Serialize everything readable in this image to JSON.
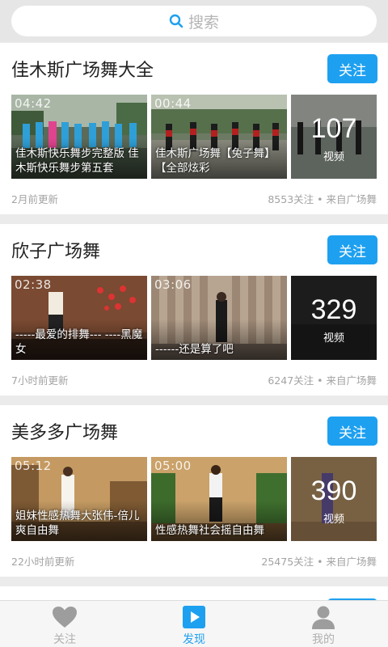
{
  "search": {
    "placeholder": "搜索"
  },
  "channels": [
    {
      "title": "佳木斯广场舞大全",
      "follow_label": "关注",
      "videos": [
        {
          "duration": "04:42",
          "caption": "佳木斯快乐舞步完整版 佳木斯快乐舞步第五套"
        },
        {
          "duration": "00:44",
          "caption": "佳木斯广场舞【兔子舞】【全部炫彩"
        }
      ],
      "video_count": "107",
      "video_count_label": "视频",
      "updated": "2月前更新",
      "stats": "8553关注 • 来自广场舞"
    },
    {
      "title": "欣子广场舞",
      "follow_label": "关注",
      "videos": [
        {
          "duration": "02:38",
          "caption": "-----最爱的排舞--- ----黑魔女"
        },
        {
          "duration": "03:06",
          "caption": "------还是算了吧"
        }
      ],
      "video_count": "329",
      "video_count_label": "视频",
      "updated": "7小时前更新",
      "stats": "6247关注 • 来自广场舞"
    },
    {
      "title": "美多多广场舞",
      "follow_label": "关注",
      "videos": [
        {
          "duration": "05:12",
          "caption": "姐妹性感热舞大张伟-倍儿爽自由舞"
        },
        {
          "duration": "05:00",
          "caption": "性感热舞社会摇自由舞"
        }
      ],
      "video_count": "390",
      "video_count_label": "视频",
      "updated": "22小时前更新",
      "stats": "25475关注 • 来自广场舞"
    }
  ],
  "tabbar": {
    "tabs": [
      {
        "label": "关注",
        "icon": "heart-icon"
      },
      {
        "label": "发现",
        "icon": "play-icon"
      },
      {
        "label": "我的",
        "icon": "person-icon"
      }
    ],
    "active_index": 1,
    "active_color": "#1ea0f0",
    "inactive_color": "#b0b0b0"
  },
  "colors": {
    "accent": "#1ea0f0",
    "background": "#ebebeb"
  }
}
